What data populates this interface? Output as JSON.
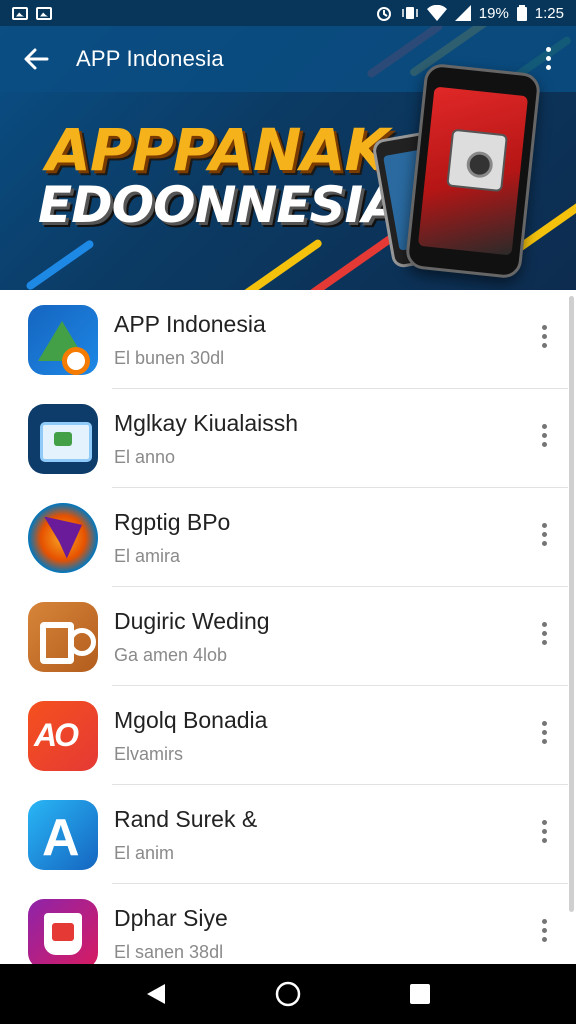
{
  "status_bar": {
    "battery_percent": "19%",
    "time": "1:25"
  },
  "header": {
    "title": "APP Indonesia",
    "banner_line1": "APPPANAK",
    "banner_line2": "EDOONNESIA"
  },
  "apps": [
    {
      "name": "APP Indonesia",
      "subtitle": "El bunen 30dl",
      "icon": "app-indonesia-icon"
    },
    {
      "name": "Mglkay Kiualaissh",
      "subtitle": "El anno",
      "icon": "browser-window-icon"
    },
    {
      "name": "Rgptig BPo",
      "subtitle": "El amira",
      "icon": "game-emblem-icon"
    },
    {
      "name": "Dugiric Weding",
      "subtitle": "Ga amen 4lob",
      "icon": "do-logo-icon"
    },
    {
      "name": "Mgolq Bonadia",
      "subtitle": "Elvamirs",
      "icon": "ao-logo-icon"
    },
    {
      "name": "Rand Surek &",
      "subtitle": "El anim",
      "icon": "letter-a-icon"
    },
    {
      "name": "Dphar Siye",
      "subtitle": "El sanen 38dl",
      "icon": "shield-icon"
    }
  ],
  "icon_glyphs": {
    "ao": "AO",
    "a": "A"
  },
  "colors": {
    "header_blue": "#0a4d83",
    "banner_orange": "#f6b21a",
    "navbar": "#000000"
  }
}
